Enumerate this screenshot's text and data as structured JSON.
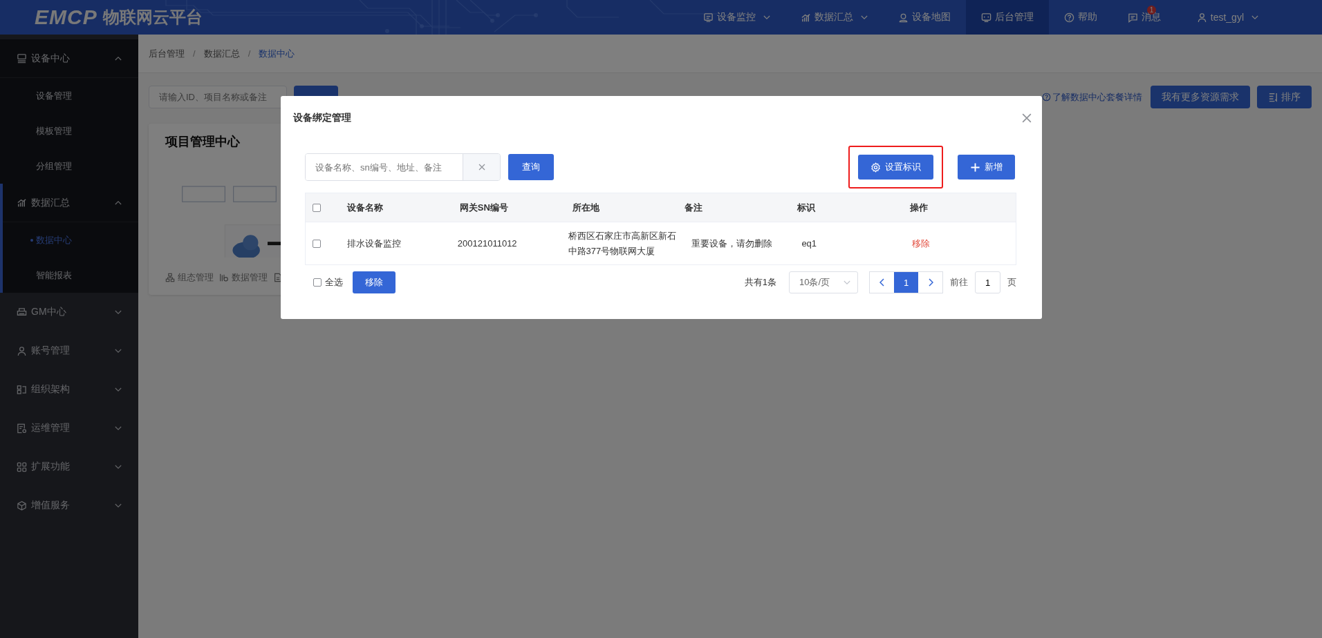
{
  "header": {
    "logo": "EMCP",
    "platform_name": "物联网云平台",
    "nav": [
      {
        "label": "设备监控",
        "kind": "monitor",
        "dropdown": true,
        "selected": false
      },
      {
        "label": "数据汇总",
        "kind": "chart",
        "dropdown": true,
        "selected": false
      },
      {
        "label": "设备地图",
        "kind": "pin",
        "dropdown": false,
        "selected": false
      },
      {
        "label": "后台管理",
        "kind": "console",
        "dropdown": false,
        "selected": true
      },
      {
        "label": "帮助",
        "kind": "help",
        "dropdown": false,
        "selected": false
      },
      {
        "label": "消息",
        "kind": "message",
        "dropdown": false,
        "selected": false,
        "badge": "1"
      }
    ],
    "user": {
      "name": "test_gyl"
    }
  },
  "sidebar": {
    "groups": [
      {
        "label": "设备中心",
        "kind": "device",
        "expanded": true,
        "children": [
          {
            "label": "设备管理",
            "selected": false
          },
          {
            "label": "模板管理",
            "selected": false
          },
          {
            "label": "分组管理",
            "selected": false
          }
        ]
      },
      {
        "label": "数据汇总",
        "kind": "chart",
        "expanded": true,
        "children": [
          {
            "label": "数据中心",
            "selected": true
          },
          {
            "label": "智能报表",
            "selected": false
          }
        ]
      },
      {
        "label": "GM中心",
        "kind": "gm",
        "expanded": false
      },
      {
        "label": "账号管理",
        "kind": "user",
        "expanded": false
      },
      {
        "label": "组织架构",
        "kind": "org",
        "expanded": false
      },
      {
        "label": "运维管理",
        "kind": "ops",
        "expanded": false
      },
      {
        "label": "扩展功能",
        "kind": "grid",
        "expanded": false
      },
      {
        "label": "增值服务",
        "kind": "cube",
        "expanded": false
      }
    ]
  },
  "breadcrumb": {
    "separator": "/",
    "items": [
      "后台管理",
      "数据汇总",
      "数据中心"
    ]
  },
  "toolbar": {
    "search": {
      "placeholder": "请输入ID、项目名称或备注"
    },
    "info_link": "了解数据中心套餐详情",
    "buttons": [
      {
        "label": "我有更多资源需求",
        "kind": "text"
      },
      {
        "label": "排序",
        "kind": "sort"
      }
    ]
  },
  "project_card": {
    "title": "项目管理中心",
    "actions": [
      {
        "label": "组态管理",
        "kind": "topology"
      },
      {
        "label": "数据管理",
        "kind": "data"
      },
      {
        "kind": "document"
      }
    ]
  },
  "modal": {
    "title": "设备绑定管理",
    "search": {
      "placeholder": "设备名称、sn编号、地址、备注"
    },
    "query_button": "查询",
    "actions": [
      {
        "label": "设置标识",
        "kind": "settings",
        "highlighted": true
      },
      {
        "label": "新增",
        "kind": "add",
        "highlighted": false
      }
    ],
    "table": {
      "select_all_checked": false,
      "columns": [
        "设备名称",
        "网关SN编号",
        "所在地",
        "备注",
        "标识",
        "操作"
      ],
      "rows": [
        {
          "checked": false,
          "cells": [
            "排水设备监控",
            "200121011012",
            "桥西区石家庄市高新区新石中路377号物联网大厦",
            "重要设备，请勿删除",
            "eq1",
            "移除"
          ]
        }
      ]
    },
    "footer": {
      "select_all": {
        "label": "全选",
        "checked": false
      },
      "remove_button": "移除"
    },
    "pagination": {
      "total": "共有1条",
      "page_size": "10条/页",
      "pages": [
        {
          "label": "1",
          "selected": true
        }
      ],
      "goto_label": "前往",
      "goto_value": "1",
      "goto_suffix": "页"
    }
  }
}
